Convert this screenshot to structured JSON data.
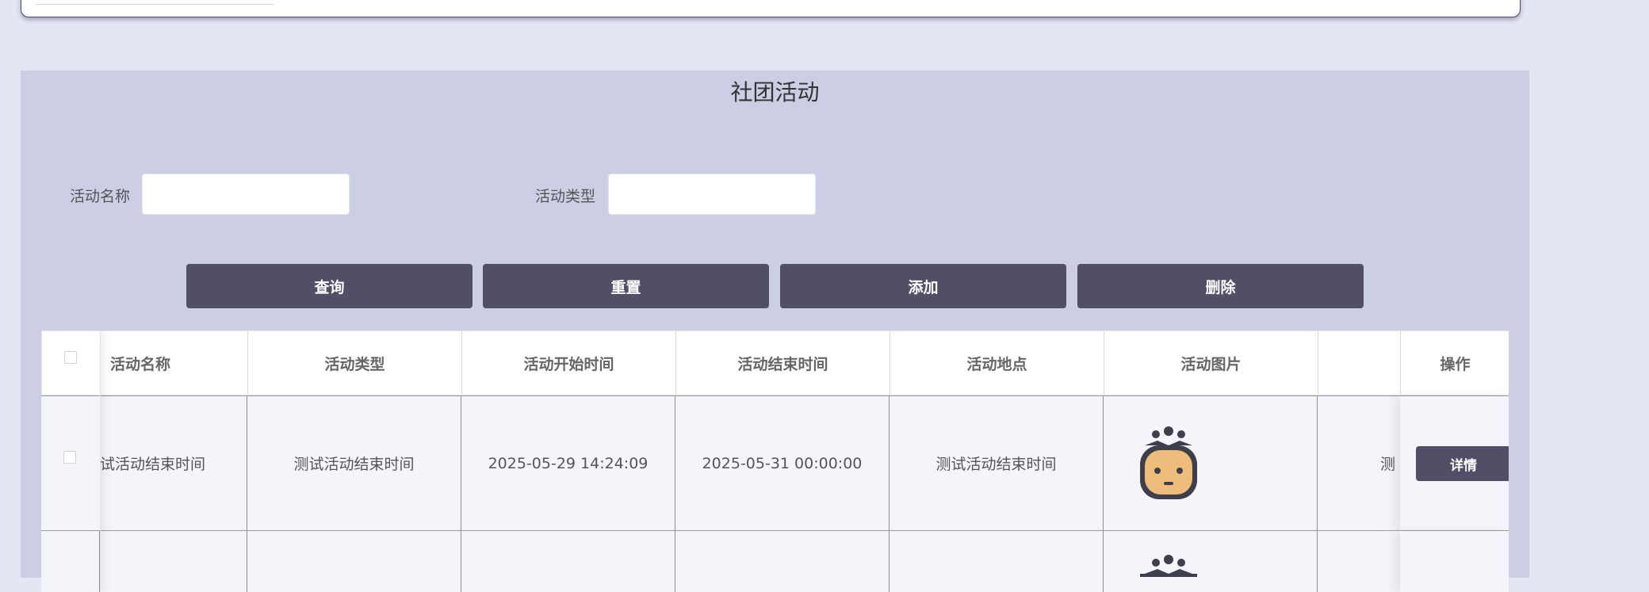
{
  "page": {
    "title": "社团活动"
  },
  "search": {
    "fields": [
      {
        "label": "活动名称",
        "value": "",
        "placeholder": ""
      },
      {
        "label": "活动类型",
        "value": "",
        "placeholder": ""
      }
    ]
  },
  "toolbar": {
    "query_label": "查询",
    "reset_label": "重置",
    "add_label": "添加",
    "delete_label": "删除"
  },
  "table": {
    "columns": [
      "活动名称",
      "活动类型",
      "活动开始时间",
      "活动结束时间",
      "活动地点",
      "活动图片",
      "操作"
    ],
    "rows": [
      {
        "name": "试活动结束时间",
        "type": "测试活动结束时间",
        "start": "2025-05-29 14:24:09",
        "end": "2025-05-31 00:00:00",
        "location": "测试活动结束时间",
        "image": "robot-avatar-icon",
        "overflow_text": "测",
        "action": "详情"
      }
    ]
  },
  "colors": {
    "page_bg": "#e4e6f4",
    "panel_bg": "#cccee5",
    "button_bg": "#524e68",
    "row_bg": "#f4f5fa"
  }
}
